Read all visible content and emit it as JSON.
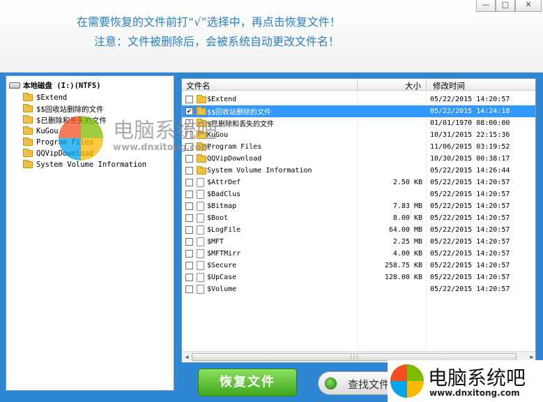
{
  "header": {
    "instruction_line1": "在需要恢复的文件前打“√”选择中，再点击恢复文件！",
    "instruction_line2": "注意：文件被删除后，会被系统自动更改文件名！"
  },
  "window_controls": {
    "minimize": "—",
    "maximize": "□",
    "close": "✕"
  },
  "tree": {
    "root_label": "本地磁盘 (I:)(NTFS)",
    "items": [
      "$Extend",
      "$$回收站删除的文件",
      "$已删除和丢失的文件",
      "KuGou",
      "Program Files",
      "QQVipDownload",
      "System Volume Information"
    ]
  },
  "list": {
    "columns": {
      "name": "文件名",
      "size": "大小",
      "date": "修改时间"
    },
    "rows": [
      {
        "type": "folder",
        "name": "$Extend",
        "size": "",
        "date": "05/22/2015 14:20:57",
        "checked": false,
        "selected": false
      },
      {
        "type": "folder",
        "name": "$$回收站删除的文件",
        "size": "",
        "date": "05/22/2015 14:24:18",
        "checked": true,
        "selected": true
      },
      {
        "type": "folder",
        "name": "$已删除和丢失的文件",
        "size": "",
        "date": "01/01/1970 08:00:00",
        "checked": false,
        "selected": false
      },
      {
        "type": "folder",
        "name": "KuGou",
        "size": "",
        "date": "10/31/2015 22:15:36",
        "checked": false,
        "selected": false
      },
      {
        "type": "folder",
        "name": "Program Files",
        "size": "",
        "date": "11/06/2015 03:19:52",
        "checked": false,
        "selected": false
      },
      {
        "type": "folder",
        "name": "QQVipDownload",
        "size": "",
        "date": "10/30/2015 00:38:17",
        "checked": false,
        "selected": false
      },
      {
        "type": "folder",
        "name": "System Volume Information",
        "size": "",
        "date": "05/22/2015 14:26:44",
        "checked": false,
        "selected": false
      },
      {
        "type": "file",
        "name": "$AttrDef",
        "size": "2.50 KB",
        "date": "05/22/2015 14:20:57",
        "checked": false,
        "selected": false
      },
      {
        "type": "file",
        "name": "$BadClus",
        "size": "",
        "date": "05/22/2015 14:20:57",
        "checked": false,
        "selected": false
      },
      {
        "type": "file",
        "name": "$Bitmap",
        "size": "7.83 MB",
        "date": "05/22/2015 14:20:57",
        "checked": false,
        "selected": false
      },
      {
        "type": "file",
        "name": "$Boot",
        "size": "8.00 KB",
        "date": "05/22/2015 14:20:57",
        "checked": false,
        "selected": false
      },
      {
        "type": "file",
        "name": "$LogFile",
        "size": "64.00 MB",
        "date": "05/22/2015 14:20:57",
        "checked": false,
        "selected": false
      },
      {
        "type": "file",
        "name": "$MFT",
        "size": "2.25 MB",
        "date": "05/22/2015 14:20:57",
        "checked": false,
        "selected": false
      },
      {
        "type": "file",
        "name": "$MFTMirr",
        "size": "4.00 KB",
        "date": "05/22/2015 14:20:57",
        "checked": false,
        "selected": false
      },
      {
        "type": "file",
        "name": "$Secure",
        "size": "258.75 KB",
        "date": "05/22/2015 14:20:57",
        "checked": false,
        "selected": false
      },
      {
        "type": "file",
        "name": "$UpCase",
        "size": "128.00 KB",
        "date": "05/22/2015 14:20:57",
        "checked": false,
        "selected": false
      },
      {
        "type": "file",
        "name": "$Volume",
        "size": "",
        "date": "05/22/2015 14:20:57",
        "checked": false,
        "selected": false
      }
    ]
  },
  "scrollbar": {
    "grip": "|||"
  },
  "buttons": {
    "recover": "恢复文件",
    "find": "查找文件"
  },
  "watermark": {
    "brand": "电脑系统吧",
    "url": "www.dnxitong.com",
    "brand_small": "电脑系统吧",
    "url_small": "www.dnxitong.com"
  },
  "colors": {
    "accent_blue": "#2f86d3",
    "selection": "#3399ff",
    "button_green": "#3ea81e",
    "instruction_text": "#2b7fc4"
  }
}
